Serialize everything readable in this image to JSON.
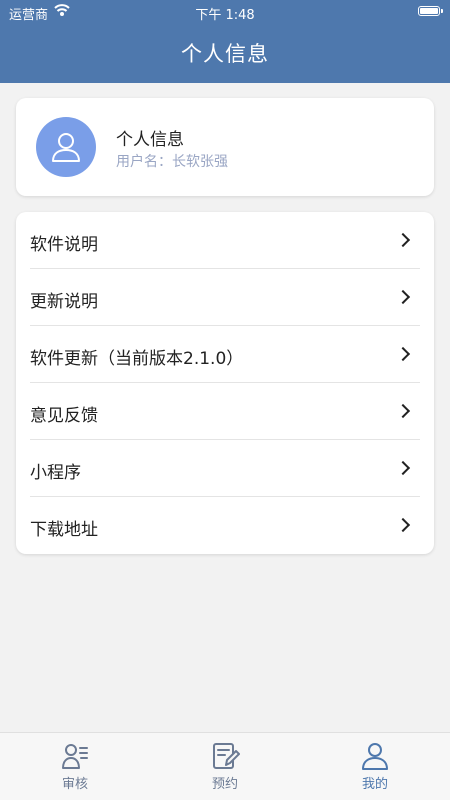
{
  "status_bar": {
    "carrier": "运营商",
    "time": "下午 1:48"
  },
  "header": {
    "title": "个人信息"
  },
  "profile": {
    "name": "个人信息",
    "username": "用户名：长软张强",
    "avatar_icon": "user-icon",
    "avatar_color": "#7a9ee8"
  },
  "menu": {
    "items": [
      {
        "label": "软件说明"
      },
      {
        "label": "更新说明"
      },
      {
        "label": "软件更新（当前版本2.1.0）"
      },
      {
        "label": "意见反馈"
      },
      {
        "label": "小程序"
      },
      {
        "label": "下载地址"
      }
    ]
  },
  "tabbar": {
    "tabs": [
      {
        "label": "审核",
        "icon": "review-icon"
      },
      {
        "label": "预约",
        "icon": "appointment-icon"
      },
      {
        "label": "我的",
        "icon": "user-icon",
        "active": true
      }
    ]
  },
  "colors": {
    "header": "#4e78ad",
    "accent": "#4e78ad",
    "tab_inactive": "#6b7a93"
  }
}
